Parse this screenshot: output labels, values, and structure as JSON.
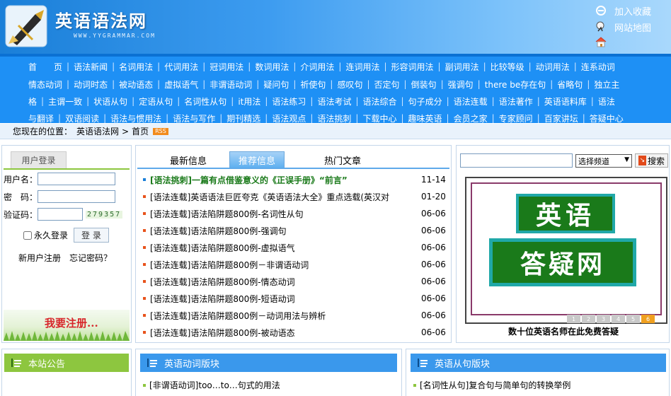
{
  "header": {
    "site_title": "英语语法网",
    "site_url": "WWW.YYGRAMMAR.COM",
    "links": [
      {
        "label": "加入收藏",
        "icon": "ie-favorites-icon"
      },
      {
        "label": "网站地图",
        "icon": "sitemap-icon"
      },
      {
        "label": "",
        "icon": "home-icon"
      }
    ]
  },
  "nav": {
    "rows": [
      [
        "首　　页",
        "语法新闻",
        "名词用法",
        "代词用法",
        "冠词用法",
        "数词用法",
        "介词用法",
        "连词用法",
        "形容词用法",
        "副词用法",
        "比较等级",
        "动词用法",
        "连系动词"
      ],
      [
        "情态动词",
        "动词时态",
        "被动语态",
        "虚拟语气",
        "非谓语动词",
        "疑问句",
        "祈使句",
        "感叹句",
        "否定句",
        "倒装句",
        "强调句",
        "there be存在句",
        "省略句",
        "独立主"
      ],
      [
        "格",
        "主谓一致",
        "状语从句",
        "定语从句",
        "名词性从句",
        "it用法",
        "语法练习",
        "语法考试",
        "语法综合",
        "句子成分",
        "语法连载",
        "语法著作",
        "英语语料库",
        "语法"
      ],
      [
        "与翻译",
        "双语阅读",
        "语法与惯用法",
        "语法与写作",
        "期刊精选",
        "语法观点",
        "语法挑刺",
        "下载中心",
        "趣味英语",
        "会员之家",
        "专家顾问",
        "百家讲坛",
        "答疑中心"
      ]
    ]
  },
  "location": {
    "prefix": "您现在的位置：",
    "crumb_site": "英语语法网",
    "sep": ">",
    "crumb_page": "首页",
    "rss": "RSS"
  },
  "login": {
    "tab": "用户登录",
    "username_label": "用户名：",
    "password_label": "密　码：",
    "captcha_label": "验证码：",
    "captcha_code": "279357",
    "remember_label": "永久登录",
    "login_button": "登 录",
    "register_link": "新用户注册",
    "forgot_link": "忘记密码？",
    "banner_text": "我要注册..."
  },
  "news": {
    "tabs": [
      "最新信息",
      "推荐信息",
      "热门文章"
    ],
    "active_tab": 1,
    "items": [
      {
        "title": "[语法挑刺]一篇有点借鉴意义的《正误手册》“前言”",
        "date": "11-14",
        "highlight": true
      },
      {
        "title": "[语法连载]英语语法巨匠夸克《英语语法大全》重点选载(英汉对",
        "date": "01-20",
        "highlight": false
      },
      {
        "title": "[语法连载]语法陷阱题800例-名词性从句",
        "date": "06-06",
        "highlight": false
      },
      {
        "title": "[语法连载]语法陷阱题800例-强调句",
        "date": "06-06",
        "highlight": false
      },
      {
        "title": "[语法连载]语法陷阱题800例-虚拟语气",
        "date": "06-06",
        "highlight": false
      },
      {
        "title": "[语法连载]语法陷阱题800例－非谓语动词",
        "date": "06-06",
        "highlight": false
      },
      {
        "title": "[语法连载]语法陷阱题800例-情态动词",
        "date": "06-06",
        "highlight": false
      },
      {
        "title": "[语法连载]语法陷阱题800例-短语动词",
        "date": "06-06",
        "highlight": false
      },
      {
        "title": "[语法连载]语法陷阱题800例－动词用法与辨析",
        "date": "06-06",
        "highlight": false
      },
      {
        "title": "[语法连载]语法陷阱题800例-被动语态",
        "date": "06-06",
        "highlight": false
      }
    ]
  },
  "search": {
    "select_value": "选择频道",
    "button": "搜索"
  },
  "promo": {
    "line1": "英语",
    "line2": "答疑网",
    "pages": [
      "1",
      "2",
      "3",
      "4",
      "5",
      "6"
    ],
    "active_page": 5,
    "caption": "数十位英语名师在此免费答疑"
  },
  "bottom": {
    "notice_title": "本站公告",
    "verb_title": "英语动词版块",
    "verb_item": "[非谓语动词]too…to…句式的用法",
    "clause_title": "英语从句版块",
    "clause_item": "[名词性从句]复合句与简单句的转换举例"
  },
  "colors": {
    "nav_bg": "#1e90f5",
    "highlight_green": "#1a7a1a",
    "bottom_head_blue": "#3a98ec",
    "notice_head_green": "#8dc63f"
  }
}
